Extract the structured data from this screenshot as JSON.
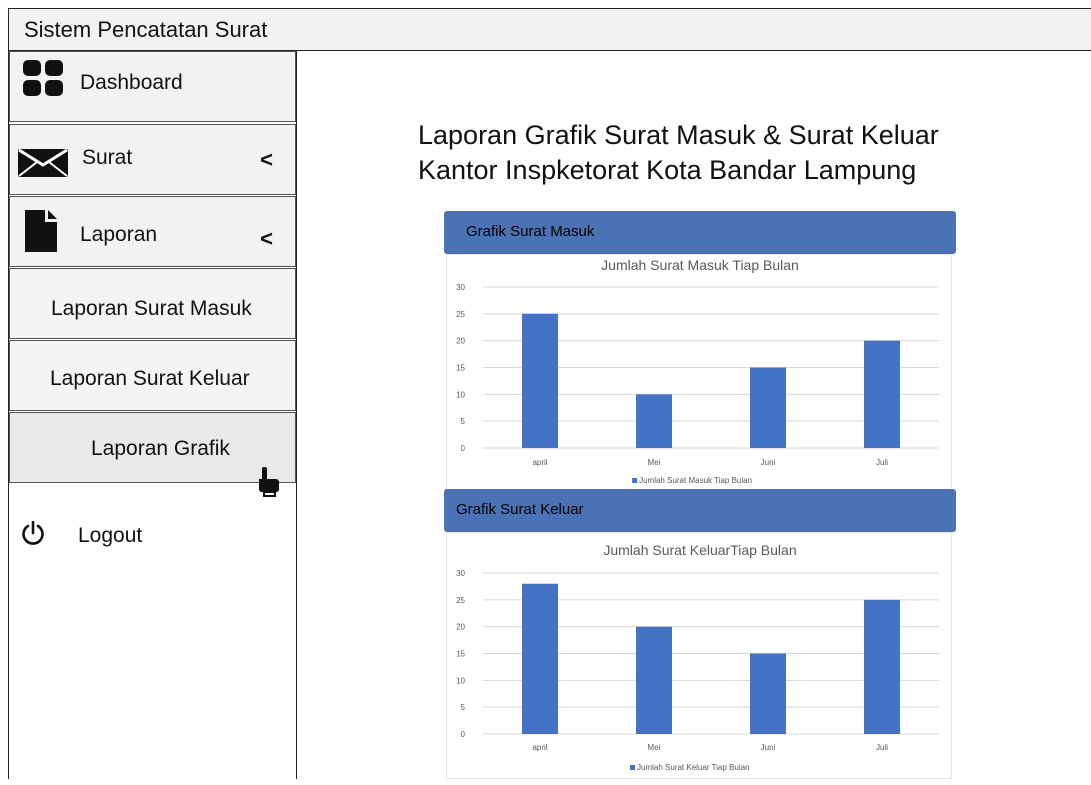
{
  "app": {
    "title": "Sistem Pencatatan Surat"
  },
  "sidebar": {
    "items": [
      {
        "label": "Dashboard",
        "icon": "dashboard-icon"
      },
      {
        "label": "Surat",
        "icon": "envelope-icon",
        "chevron": "<"
      },
      {
        "label": "Laporan",
        "icon": "document-icon",
        "chevron": "<"
      },
      {
        "label": "Laporan Surat Masuk"
      },
      {
        "label": "Laporan Surat Keluar"
      },
      {
        "label": "Laporan Grafik",
        "active": true
      }
    ],
    "logout": {
      "label": "Logout",
      "icon": "power-icon"
    }
  },
  "main": {
    "title_line1": "Laporan Grafik Surat Masuk & Surat Keluar",
    "title_line2": "Kantor Inspketorat Kota Bandar Lampung",
    "panels": [
      {
        "header": "Grafik Surat Masuk"
      },
      {
        "header": "Grafik Surat Keluar"
      }
    ]
  },
  "colors": {
    "bar": "#4472c4",
    "panel_header": "#4a72b4",
    "grid": "#d9d9d9"
  },
  "chart_data": [
    {
      "type": "bar",
      "title": "Jumlah Surat Masuk Tiap Bulan",
      "categories": [
        "april",
        "Mei",
        "Juni",
        "Juli"
      ],
      "series": [
        {
          "name": "Jumlah Surat Masuk Tiap Bulan",
          "values": [
            25,
            10,
            15,
            20
          ]
        }
      ],
      "ylim": [
        0,
        30
      ],
      "yticks": [
        0,
        5,
        10,
        15,
        20,
        25,
        30
      ],
      "grid": true,
      "legend": "bottom"
    },
    {
      "type": "bar",
      "title": "Jumlah Surat KeluarTiap Bulan",
      "categories": [
        "april",
        "Mei",
        "Juni",
        "Juli"
      ],
      "series": [
        {
          "name": "Jumlah Surat Keluar Tiap Bulan",
          "values": [
            28,
            20,
            15,
            25
          ]
        }
      ],
      "ylim": [
        0,
        30
      ],
      "yticks": [
        0,
        5,
        10,
        15,
        20,
        25,
        30
      ],
      "grid": true,
      "legend": "bottom"
    }
  ]
}
